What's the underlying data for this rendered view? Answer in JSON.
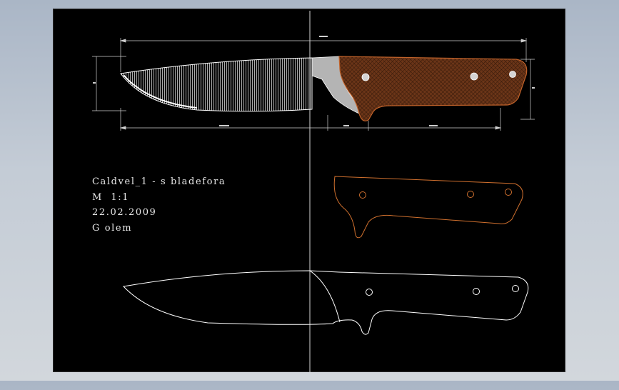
{
  "title_block": {
    "name": "Caldvel_1 - s bladefora",
    "scale": "M  1:1",
    "date": "22.02.2009",
    "author": "G olem"
  },
  "colors": {
    "background": "#000000",
    "outline": "#ffffff",
    "handle_fill": "#6b3518",
    "handle_outline": "#c0622a",
    "bolster": "#b4b4b4",
    "dimension": "#d0d0d0"
  },
  "views": [
    "knife-assembly-view",
    "handle-scale-outline",
    "full-tang-blank-outline"
  ]
}
